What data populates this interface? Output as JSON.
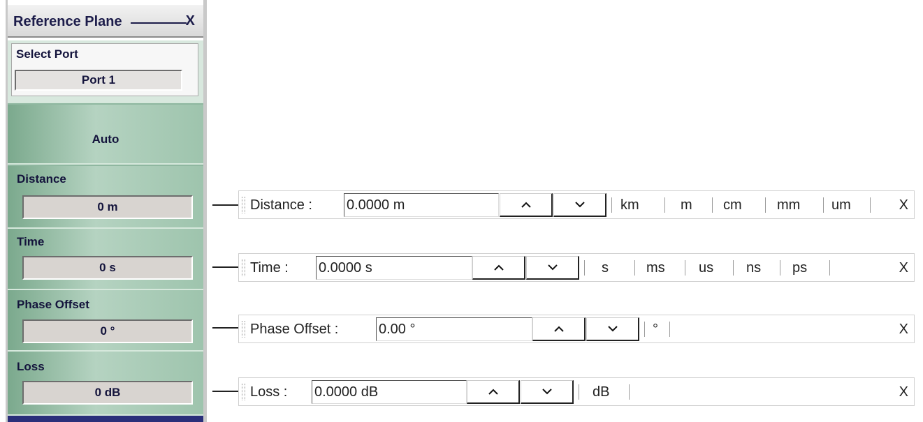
{
  "panel": {
    "title": "Reference Plane",
    "close": "X",
    "select_port_label": "Select Port",
    "port_value": "Port 1",
    "auto_label": "Auto",
    "distance_label": "Distance",
    "distance_value": "0  m",
    "time_label": "Time",
    "time_value": "0  s",
    "phase_label": "Phase Offset",
    "phase_value": "0 °",
    "loss_label": "Loss",
    "loss_value": "0  dB"
  },
  "toolbars": {
    "distance": {
      "label": "Distance  :",
      "value": "0.0000  m",
      "units": [
        "km",
        "m",
        "cm",
        "mm",
        "um"
      ],
      "close": "X"
    },
    "time": {
      "label": "Time  :",
      "value": "0.0000  s",
      "units": [
        "s",
        "ms",
        "us",
        "ns",
        "ps"
      ],
      "close": "X"
    },
    "phase": {
      "label": "Phase Offset  :",
      "value": "0.00 °",
      "units": [
        "°"
      ],
      "close": "X"
    },
    "loss": {
      "label": "Loss  :",
      "value": "0.0000  dB",
      "units": [
        "dB"
      ],
      "close": "X"
    }
  },
  "icons": {
    "up": "chevron-up-icon",
    "down": "chevron-down-icon"
  }
}
